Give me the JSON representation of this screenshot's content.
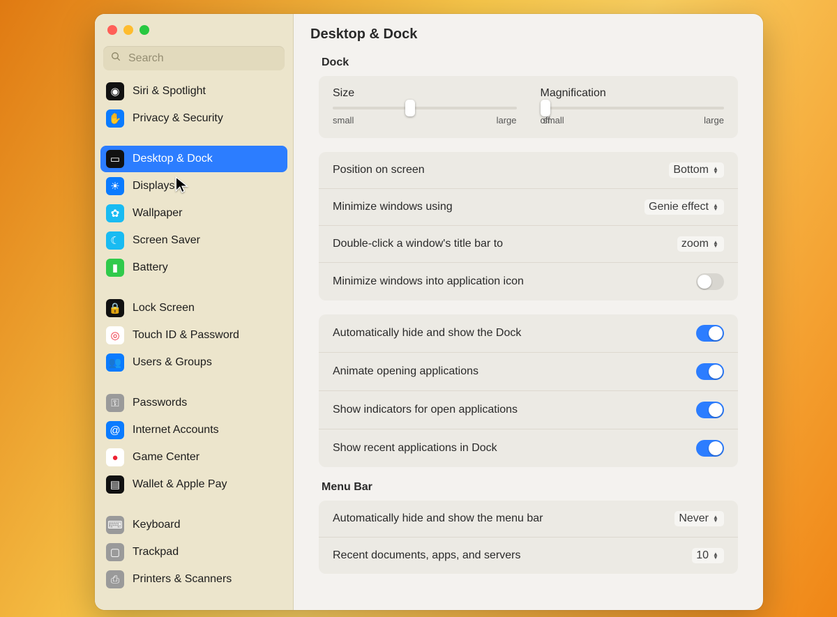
{
  "header": {
    "title": "Desktop & Dock"
  },
  "search": {
    "placeholder": "Search"
  },
  "sidebar": {
    "items": [
      {
        "label": "Siri & Spotlight",
        "icon_bg": "#111",
        "icon": "siri-icon"
      },
      {
        "label": "Privacy & Security",
        "icon_bg": "#0a7bff",
        "icon": "hand-icon"
      },
      {
        "label": "Desktop & Dock",
        "icon_bg": "#111",
        "icon": "dock-icon",
        "selected": true
      },
      {
        "label": "Displays",
        "icon_bg": "#0a7bff",
        "icon": "sun-icon"
      },
      {
        "label": "Wallpaper",
        "icon_bg": "#19bbf2",
        "icon": "flower-icon"
      },
      {
        "label": "Screen Saver",
        "icon_bg": "#19bbf2",
        "icon": "moon-icon"
      },
      {
        "label": "Battery",
        "icon_bg": "#30ca4b",
        "icon": "battery-icon"
      },
      {
        "label": "Lock Screen",
        "icon_bg": "#111",
        "icon": "lock-icon"
      },
      {
        "label": "Touch ID & Password",
        "icon_bg": "#fff",
        "icon": "fingerprint-icon"
      },
      {
        "label": "Users & Groups",
        "icon_bg": "#0a7bff",
        "icon": "users-icon"
      },
      {
        "label": "Passwords",
        "icon_bg": "#9a9a9a",
        "icon": "key-icon"
      },
      {
        "label": "Internet Accounts",
        "icon_bg": "#0a7bff",
        "icon": "at-icon"
      },
      {
        "label": "Game Center",
        "icon_bg": "#fff",
        "icon": "game-center-icon"
      },
      {
        "label": "Wallet & Apple Pay",
        "icon_bg": "#111",
        "icon": "wallet-icon"
      },
      {
        "label": "Keyboard",
        "icon_bg": "#9a9a9a",
        "icon": "keyboard-icon"
      },
      {
        "label": "Trackpad",
        "icon_bg": "#9a9a9a",
        "icon": "trackpad-icon"
      },
      {
        "label": "Printers & Scanners",
        "icon_bg": "#9a9a9a",
        "icon": "printer-icon"
      }
    ],
    "group_breaks_after": [
      1,
      6,
      9,
      13
    ]
  },
  "sections": {
    "dock_label": "Dock",
    "menubar_label": "Menu Bar"
  },
  "dock": {
    "size": {
      "title": "Size",
      "min_label": "small",
      "max_label": "large",
      "value_percent": 42
    },
    "mag": {
      "title": "Magnification",
      "off_label": "off",
      "min_label": "small",
      "max_label": "large",
      "value_percent": 3
    },
    "rows": [
      {
        "kind": "popup",
        "label": "Position on screen",
        "value": "Bottom"
      },
      {
        "kind": "popup",
        "label": "Minimize windows using",
        "value": "Genie effect"
      },
      {
        "kind": "popup",
        "label": "Double-click a window's title bar to",
        "value": "zoom"
      },
      {
        "kind": "toggle",
        "label": "Minimize windows into application icon",
        "on": false
      }
    ]
  },
  "dock2": {
    "rows": [
      {
        "kind": "toggle",
        "label": "Automatically hide and show the Dock",
        "on": true
      },
      {
        "kind": "toggle",
        "label": "Animate opening applications",
        "on": true
      },
      {
        "kind": "toggle",
        "label": "Show indicators for open applications",
        "on": true
      },
      {
        "kind": "toggle",
        "label": "Show recent applications in Dock",
        "on": true
      }
    ]
  },
  "menubar": {
    "rows": [
      {
        "kind": "popup",
        "label": "Automatically hide and show the menu bar",
        "value": "Never"
      },
      {
        "kind": "popup",
        "label": "Recent documents, apps, and servers",
        "value": "10"
      }
    ]
  }
}
